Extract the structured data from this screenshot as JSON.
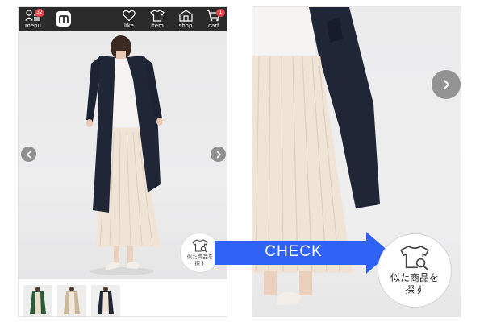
{
  "header": {
    "menu_label": "menu",
    "menu_badge": "32",
    "logo_letter": "m",
    "like_label": "like",
    "item_label": "item",
    "shop_label": "shop",
    "cart_label": "cart",
    "cart_badge": "1"
  },
  "product": {
    "similar_button_label": "似た商品を\n探す",
    "thumbnails": [
      "green-coat-outfit",
      "beige-coat-outfit",
      "navy-coat-outfit"
    ]
  },
  "callout": {
    "check_label": "CHECK",
    "similar_button_label": "似た商品を\n探す"
  },
  "icons": {
    "menu": "person-lines-icon",
    "logo": "m-logo",
    "like": "heart-icon",
    "item": "tshirt-icon",
    "shop": "store-icon",
    "cart": "cart-icon",
    "prev": "chevron-left-icon",
    "next": "chevron-right-icon",
    "similar": "tshirt-search-icon"
  },
  "colors": {
    "topbar": "#2a2a2a",
    "badge": "#e0464c",
    "check_arrow": "#2f62f5",
    "coat": "#1f2736",
    "skirt": "#efe4d6"
  }
}
